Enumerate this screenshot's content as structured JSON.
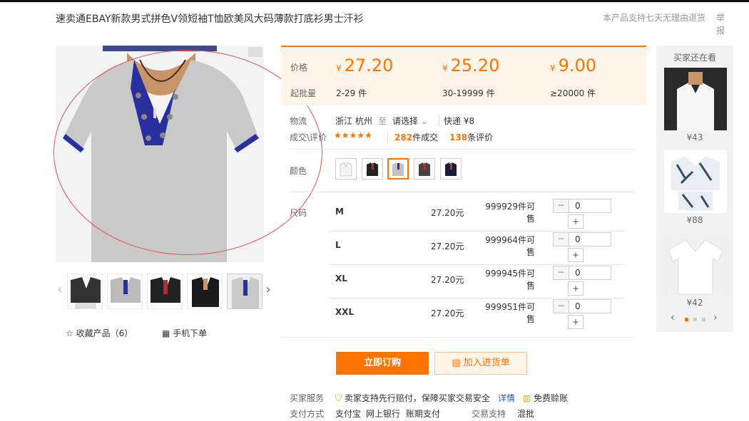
{
  "title": "速卖通EBAY新款男式拼色V领短袖T恤欧美风大码薄款打底衫男士汗衫",
  "return_note": "本产品支持七天无理由退货",
  "report": "举报",
  "favorite": {
    "label": "收藏产品（6）"
  },
  "mobile_order": {
    "label": "手机下单"
  },
  "price": {
    "price_label": "价格",
    "moq_label": "起批量",
    "currency": "¥",
    "tiers": [
      {
        "price": "27.20",
        "qty": "2-29 件"
      },
      {
        "price": "25.20",
        "qty": "30-19999 件"
      },
      {
        "price": "9.00",
        "qty": "≥20000 件"
      }
    ]
  },
  "logistics": {
    "label": "物流",
    "from": "浙江 杭州",
    "to_word": "至",
    "select": "请选择",
    "express": "快递 ¥8"
  },
  "deals": {
    "label": "成交\\评价",
    "stars": "★★★★★",
    "deal_count": "282",
    "deal_suffix": "件成交",
    "review_count": "138",
    "review_suffix": "条评价"
  },
  "color": {
    "label": "颜色"
  },
  "size": {
    "label": "尺码",
    "rows": [
      {
        "name": "M",
        "price": "27.20元",
        "stock": "999929件可售",
        "qty": "0"
      },
      {
        "name": "L",
        "price": "27.20元",
        "stock": "999964件可售",
        "qty": "0"
      },
      {
        "name": "XL",
        "price": "27.20元",
        "stock": "999945件可售",
        "qty": "0"
      },
      {
        "name": "XXL",
        "price": "27.20元",
        "stock": "999951件可售",
        "qty": "0"
      }
    ]
  },
  "actions": {
    "buy": "立即订购",
    "cart": "加入进货单"
  },
  "service": {
    "label": "买家服务",
    "text": "卖家支持先行赔付，保障买家交易安全",
    "detail": "详情",
    "extra": "免费赊账"
  },
  "payment": {
    "label": "支付方式",
    "methods": [
      "支付宝",
      "网上银行",
      "账期支付"
    ],
    "trade_label": "交易支持",
    "trade_value": "混批"
  },
  "recommend": {
    "title": "买家还在看",
    "items": [
      {
        "price": "¥43"
      },
      {
        "price": "¥88"
      },
      {
        "price": "¥42"
      }
    ]
  },
  "colors": {
    "accent": "#ff7300",
    "price_bg": "#fff4e8"
  }
}
